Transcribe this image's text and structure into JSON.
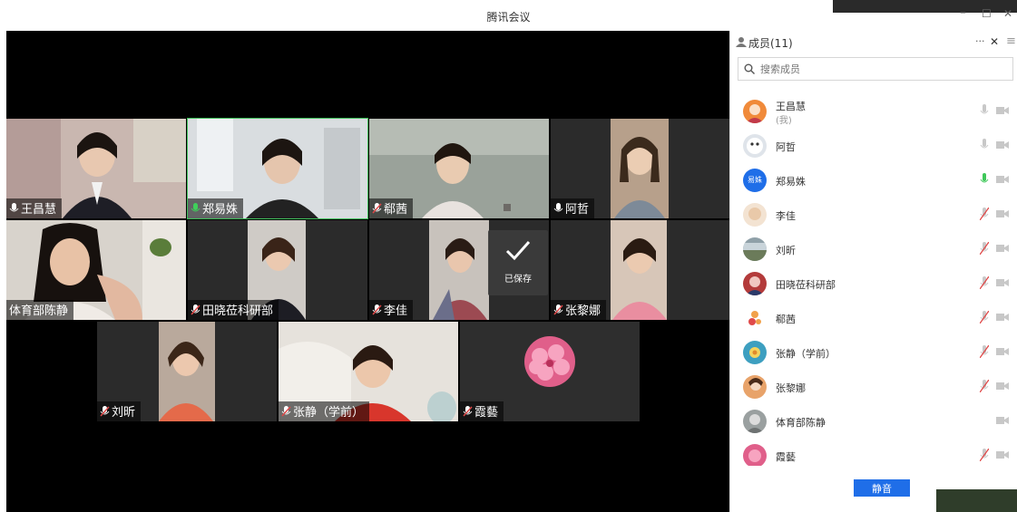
{
  "window": {
    "title": "腾讯会议",
    "minimize_icon": "–",
    "maximize_icon": "☐",
    "close_icon": "✕"
  },
  "toast": {
    "text": "已保存",
    "icon": "check-icon"
  },
  "tiles": [
    {
      "name": "王昌慧",
      "mic": "on"
    },
    {
      "name": "郑易姝",
      "mic": "on"
    },
    {
      "name": "郗茜",
      "mic": "muted"
    },
    {
      "name": "阿哲",
      "mic": "on"
    },
    {
      "name": "体育部陈静",
      "mic": "none"
    },
    {
      "name": "田晓莅科研部",
      "mic": "muted"
    },
    {
      "name": "李佳",
      "mic": "muted"
    },
    {
      "name": "张黎娜",
      "mic": "muted"
    },
    {
      "name": "刘昕",
      "mic": "muted"
    },
    {
      "name": "张静（学前）",
      "mic": "muted"
    },
    {
      "name": "霞藝",
      "mic": "muted"
    }
  ],
  "panel": {
    "title": "成员(11)",
    "more_icon": "···",
    "close_icon": "✕",
    "menu_icon": "≡",
    "search_placeholder": "搜索成员",
    "mute_all_button": "静音"
  },
  "members": [
    {
      "name": "王昌慧",
      "sub": "(我)",
      "mic": "off-gray",
      "cam": "off"
    },
    {
      "name": "阿哲",
      "sub": "",
      "mic": "off-gray",
      "cam": "off"
    },
    {
      "name": "郑易姝",
      "sub": "",
      "mic": "on-green",
      "cam": "off",
      "avatar_text": "易姝"
    },
    {
      "name": "李佳",
      "sub": "",
      "mic": "muted",
      "cam": "off"
    },
    {
      "name": "刘昕",
      "sub": "",
      "mic": "muted",
      "cam": "off"
    },
    {
      "name": "田晓莅科研部",
      "sub": "",
      "mic": "muted",
      "cam": "off"
    },
    {
      "name": "郗茜",
      "sub": "",
      "mic": "muted",
      "cam": "off"
    },
    {
      "name": "张静（学前）",
      "sub": "",
      "mic": "muted",
      "cam": "off"
    },
    {
      "name": "张黎娜",
      "sub": "",
      "mic": "muted",
      "cam": "off"
    },
    {
      "name": "体育部陈静",
      "sub": "",
      "mic": "none",
      "cam": "off"
    },
    {
      "name": "霞藝",
      "sub": "",
      "mic": "muted",
      "cam": "off"
    }
  ],
  "colors": {
    "accent": "#1f6ee8",
    "active_speaker": "#3fbf5a",
    "muted": "#e04a4a"
  }
}
